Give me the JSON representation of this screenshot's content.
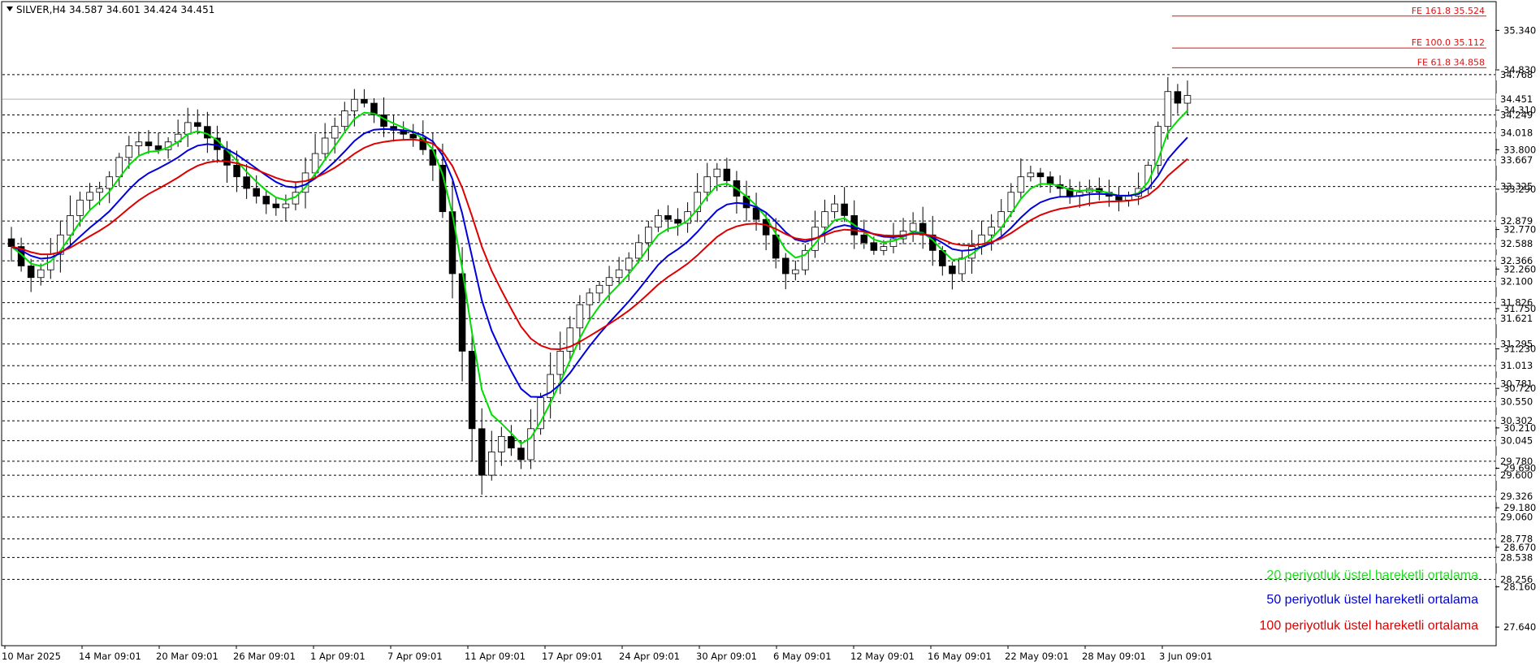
{
  "title": "SILVER,H4  34.587 34.601 34.424 34.451",
  "chart_data": {
    "type": "candlestick",
    "symbol": "SILVER",
    "timeframe": "H4",
    "ohlc_header": {
      "open": 34.587,
      "high": 34.601,
      "low": 34.424,
      "close": 34.451
    },
    "ylim": [
      27.4,
      35.7
    ],
    "y_ticks": [
      35.34,
      34.83,
      34.31,
      33.8,
      33.29,
      32.77,
      32.26,
      31.75,
      31.23,
      30.72,
      30.21,
      29.69,
      29.18,
      28.67,
      28.16,
      27.64
    ],
    "y_tick_labels": [
      "35.340",
      "34.830",
      "34.310",
      "33.800",
      "33.290",
      "32.770",
      "32.260",
      "31.750",
      "31.230",
      "30.720",
      "30.210",
      "29.690",
      "29.180",
      "28.670",
      "28.160",
      "27.640"
    ],
    "x_labels": [
      "10 Mar 2025",
      "14 Mar 09:01",
      "20 Mar 09:01",
      "26 Mar 09:01",
      "1 Apr 09:01",
      "7 Apr 09:01",
      "11 Apr 09:01",
      "17 Apr 09:01",
      "24 Apr 09:01",
      "30 Apr 09:01",
      "6 May 09:01",
      "12 May 09:01",
      "16 May 09:01",
      "22 May 09:01",
      "28 May 09:01",
      "3 Jun 09:01"
    ],
    "current_price": 34.451,
    "levels": [
      34.768,
      34.249,
      34.018,
      33.667,
      33.325,
      32.879,
      32.588,
      32.366,
      32.1,
      31.826,
      31.621,
      31.295,
      31.013,
      30.781,
      30.55,
      30.302,
      30.045,
      29.78,
      29.6,
      29.326,
      29.06,
      28.778,
      28.538,
      28.256
    ],
    "level_labels": [
      "34.768",
      "34.249",
      "34.018",
      "33.667",
      "33.325",
      "32.879",
      "32.588",
      "32.366",
      "32.100",
      "31.826",
      "31.621",
      "31.295",
      "31.013",
      "30.781",
      "30.550",
      "30.302",
      "30.045",
      "29.780",
      "29.600",
      "29.326",
      "29.060",
      "28.778",
      "28.538",
      "28.256"
    ],
    "fibonacci": [
      {
        "label": "FE 161.8 35.524",
        "value": 35.524
      },
      {
        "label": "FE 100.0 35.112",
        "value": 35.112
      },
      {
        "label": "FE 61.8 34.858",
        "value": 34.858
      }
    ],
    "closes": [
      32.55,
      32.3,
      32.15,
      32.25,
      32.45,
      32.7,
      32.95,
      33.15,
      33.25,
      33.3,
      33.45,
      33.7,
      33.85,
      33.9,
      33.85,
      33.8,
      33.9,
      34.0,
      34.15,
      34.1,
      33.95,
      33.8,
      33.6,
      33.45,
      33.3,
      33.2,
      33.1,
      33.05,
      33.1,
      33.25,
      33.5,
      33.75,
      33.95,
      34.1,
      34.3,
      34.45,
      34.4,
      34.25,
      34.1,
      34.05,
      34.0,
      33.95,
      33.8,
      33.6,
      33.0,
      32.2,
      31.2,
      30.2,
      29.6,
      29.9,
      30.1,
      29.95,
      29.8,
      30.2,
      30.6,
      30.9,
      31.2,
      31.5,
      31.8,
      31.95,
      32.05,
      32.15,
      32.25,
      32.4,
      32.6,
      32.8,
      32.95,
      32.9,
      32.85,
      33.0,
      33.25,
      33.45,
      33.55,
      33.4,
      33.2,
      33.05,
      32.9,
      32.7,
      32.4,
      32.2,
      32.25,
      32.5,
      32.8,
      33.0,
      33.1,
      32.95,
      32.7,
      32.6,
      32.5,
      32.55,
      32.65,
      32.75,
      32.85,
      32.7,
      32.5,
      32.3,
      32.2,
      32.4,
      32.55,
      32.7,
      32.8,
      33.0,
      33.25,
      33.45,
      33.5,
      33.45,
      33.35,
      33.3,
      33.2,
      33.25,
      33.3,
      33.25,
      33.2,
      33.15,
      33.2,
      33.3,
      33.6,
      34.1,
      34.55,
      34.4,
      34.5
    ],
    "ema_series": [
      {
        "name": "20 periyotluk üstel hareketli ortalama",
        "color": "#00dd00"
      },
      {
        "name": "50 periyotluk üstel hareketli ortalama",
        "color": "#0000dd"
      },
      {
        "name": "100 periyotluk üstel hareketli ortalama",
        "color": "#dd0000"
      }
    ],
    "legend_position": "bottom-right"
  },
  "legend": {
    "ema20": "20 periyotluk üstel hareketli ortalama",
    "ema50": "50 periyotluk üstel hareketli ortalama",
    "ema100": "100 periyotluk üstel hareketli ortalama"
  }
}
